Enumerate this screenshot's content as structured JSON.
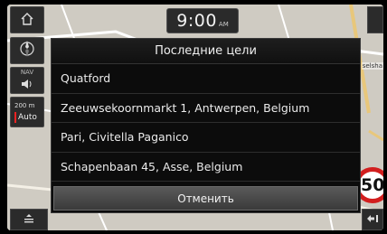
{
  "clock": {
    "time": "9:00",
    "ampm": "AM"
  },
  "left_controls": {
    "nav_label": "NAV",
    "scale_label": "200 m",
    "auto_label": "Auto"
  },
  "map": {
    "right_label": "selsha"
  },
  "speed_limit": {
    "value": "50"
  },
  "dialog": {
    "title": "Последние цели",
    "items": [
      "Quatford",
      "Zeeuwsekoornmarkt 1, Antwerpen, Belgium",
      "Pari, Civitella Paganico",
      "Schapenbaan 45, Asse, Belgium"
    ],
    "cancel_label": "Отменить"
  },
  "icons": {
    "home": "home-icon",
    "compass": "compass-icon",
    "speaker": "speaker-icon",
    "menu": "menu-icon",
    "back": "back-arrow-icon"
  }
}
